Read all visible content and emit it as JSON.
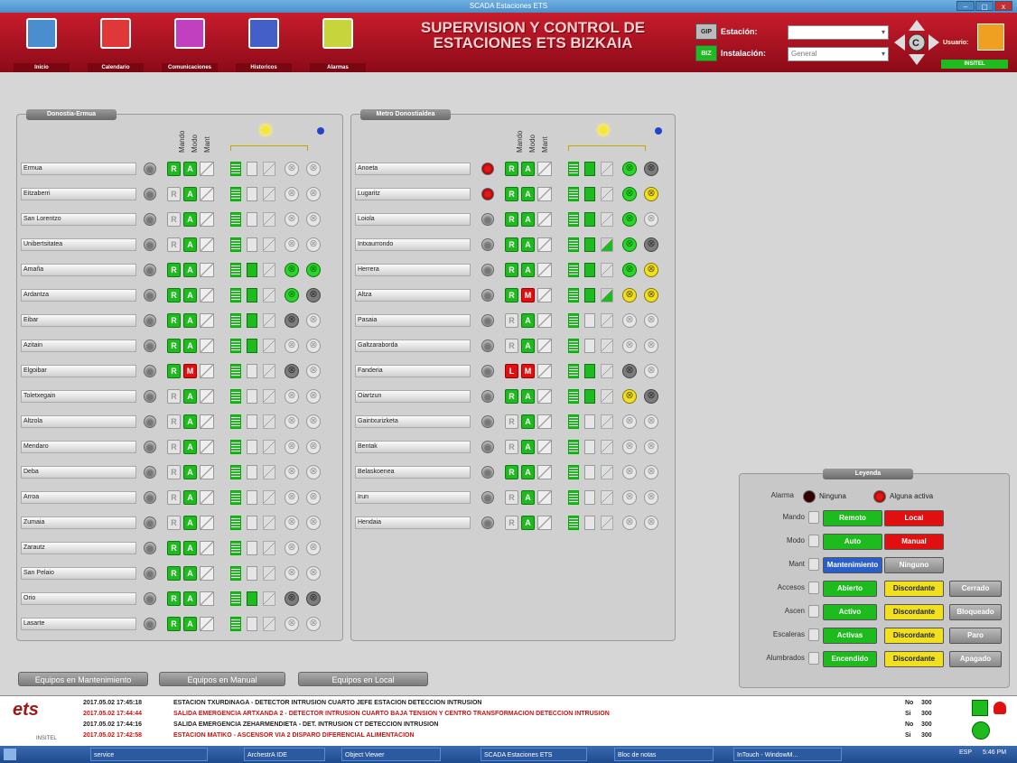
{
  "window": {
    "title": "SCADA Estaciones ETS",
    "min": "–",
    "max": "▢",
    "close": "x"
  },
  "nav": [
    {
      "label": "Inicio",
      "icon": "home-icon",
      "color": "#4a8ed0"
    },
    {
      "label": "Calendario",
      "icon": "calendar-icon",
      "color": "#e03838"
    },
    {
      "label": "Comunicaciones",
      "icon": "communications-icon",
      "color": "#c040c0"
    },
    {
      "label": "Historicos",
      "icon": "chart-icon",
      "color": "#4460c8"
    },
    {
      "label": "Alarmas",
      "icon": "alarm-warning-icon",
      "color": "#c8d43c"
    }
  ],
  "header": {
    "title_line1": "SUPERVISION Y CONTROL DE",
    "title_line2": "ESTACIONES ETS BIZKAIA",
    "gip": "GIP",
    "biz": "BIZ",
    "estacion_label": "Estación:",
    "estacion_value": "",
    "instalacion_label": "Instalación:",
    "instalacion_value": "General",
    "usuario_label": "Usuario:",
    "usuario_value": "INSITEL"
  },
  "columns": {
    "mando": "Mando",
    "modo": "Modo",
    "mant": "Mant"
  },
  "left_panel": {
    "title": "Donostia-Ermua",
    "rows": [
      {
        "n": "Ermua",
        "al": 0,
        "md": "R",
        "mdg": 1,
        "mo": "A",
        "mog": 1,
        "acc": 1,
        "asc": 0,
        "esc": 0,
        "l1": "o",
        "l2": "o"
      },
      {
        "n": "Eitzaberri",
        "al": 0,
        "md": "R",
        "mdg": 0,
        "mo": "A",
        "mog": 1,
        "acc": 1,
        "asc": 0,
        "esc": 0,
        "l1": "o",
        "l2": "o"
      },
      {
        "n": "San Lorentzo",
        "al": 0,
        "md": "R",
        "mdg": 0,
        "mo": "A",
        "mog": 1,
        "acc": 1,
        "asc": 0,
        "esc": 0,
        "l1": "o",
        "l2": "o"
      },
      {
        "n": "Unibertsitatea",
        "al": 0,
        "md": "R",
        "mdg": 0,
        "mo": "A",
        "mog": 1,
        "acc": 1,
        "asc": 0,
        "esc": 0,
        "l1": "o",
        "l2": "o"
      },
      {
        "n": "Amaña",
        "al": 0,
        "md": "R",
        "mdg": 1,
        "mo": "A",
        "mog": 1,
        "acc": 1,
        "asc": 1,
        "esc": 0,
        "l1": "g",
        "l2": "g"
      },
      {
        "n": "Ardantza",
        "al": 0,
        "md": "R",
        "mdg": 1,
        "mo": "A",
        "mog": 1,
        "acc": 1,
        "asc": 1,
        "esc": 0,
        "l1": "g",
        "l2": "d"
      },
      {
        "n": "Eibar",
        "al": 0,
        "md": "R",
        "mdg": 1,
        "mo": "A",
        "mog": 1,
        "acc": 1,
        "asc": 1,
        "esc": 0,
        "l1": "d",
        "l2": "o"
      },
      {
        "n": "Azitain",
        "al": 0,
        "md": "R",
        "mdg": 1,
        "mo": "A",
        "mog": 1,
        "acc": 1,
        "asc": 1,
        "esc": 0,
        "l1": "o",
        "l2": "o"
      },
      {
        "n": "Elgoibar",
        "al": 0,
        "md": "R",
        "mdg": 1,
        "mo": "M",
        "mog": 2,
        "acc": 1,
        "asc": 0,
        "esc": 0,
        "l1": "d",
        "l2": "o"
      },
      {
        "n": "Toletxegain",
        "al": 0,
        "md": "R",
        "mdg": 0,
        "mo": "A",
        "mog": 1,
        "acc": 1,
        "asc": 0,
        "esc": 0,
        "l1": "o",
        "l2": "o"
      },
      {
        "n": "Altzola",
        "al": 0,
        "md": "R",
        "mdg": 0,
        "mo": "A",
        "mog": 1,
        "acc": 1,
        "asc": 0,
        "esc": 0,
        "l1": "o",
        "l2": "o"
      },
      {
        "n": "Mendaro",
        "al": 0,
        "md": "R",
        "mdg": 0,
        "mo": "A",
        "mog": 1,
        "acc": 1,
        "asc": 0,
        "esc": 0,
        "l1": "o",
        "l2": "o"
      },
      {
        "n": "Deba",
        "al": 0,
        "md": "R",
        "mdg": 0,
        "mo": "A",
        "mog": 1,
        "acc": 1,
        "asc": 0,
        "esc": 0,
        "l1": "o",
        "l2": "o"
      },
      {
        "n": "Arroa",
        "al": 0,
        "md": "R",
        "mdg": 0,
        "mo": "A",
        "mog": 1,
        "acc": 1,
        "asc": 0,
        "esc": 0,
        "l1": "o",
        "l2": "o"
      },
      {
        "n": "Zumaia",
        "al": 0,
        "md": "R",
        "mdg": 0,
        "mo": "A",
        "mog": 1,
        "acc": 1,
        "asc": 0,
        "esc": 0,
        "l1": "o",
        "l2": "o"
      },
      {
        "n": "Zarautz",
        "al": 0,
        "md": "R",
        "mdg": 1,
        "mo": "A",
        "mog": 1,
        "acc": 1,
        "asc": 0,
        "esc": 0,
        "l1": "o",
        "l2": "o"
      },
      {
        "n": "San Pelaio",
        "al": 0,
        "md": "R",
        "mdg": 1,
        "mo": "A",
        "mog": 1,
        "acc": 1,
        "asc": 0,
        "esc": 0,
        "l1": "o",
        "l2": "o"
      },
      {
        "n": "Orio",
        "al": 0,
        "md": "R",
        "mdg": 1,
        "mo": "A",
        "mog": 1,
        "acc": 1,
        "asc": 1,
        "esc": 0,
        "l1": "d",
        "l2": "d"
      },
      {
        "n": "Lasarte",
        "al": 0,
        "md": "R",
        "mdg": 1,
        "mo": "A",
        "mog": 1,
        "acc": 1,
        "asc": 0,
        "esc": 0,
        "l1": "o",
        "l2": "o"
      }
    ]
  },
  "right_panel": {
    "title": "Metro Donostialdea",
    "rows": [
      {
        "n": "Anoeta",
        "al": 1,
        "md": "R",
        "mdg": 1,
        "mo": "A",
        "mog": 1,
        "acc": 1,
        "asc": 1,
        "esc": 0,
        "l1": "g",
        "l2": "d"
      },
      {
        "n": "Lugaritz",
        "al": 1,
        "md": "R",
        "mdg": 1,
        "mo": "A",
        "mog": 1,
        "acc": 1,
        "asc": 1,
        "esc": 0,
        "l1": "g",
        "l2": "y"
      },
      {
        "n": "Loiola",
        "al": 0,
        "md": "R",
        "mdg": 1,
        "mo": "A",
        "mog": 1,
        "acc": 1,
        "asc": 1,
        "esc": 0,
        "l1": "g",
        "l2": "o"
      },
      {
        "n": "Intxaurrondo",
        "al": 0,
        "md": "R",
        "mdg": 1,
        "mo": "A",
        "mog": 1,
        "acc": 1,
        "asc": 1,
        "esc": 1,
        "l1": "g",
        "l2": "d"
      },
      {
        "n": "Herrera",
        "al": 0,
        "md": "R",
        "mdg": 1,
        "mo": "A",
        "mog": 1,
        "acc": 1,
        "asc": 1,
        "esc": 0,
        "l1": "g",
        "l2": "y"
      },
      {
        "n": "Altza",
        "al": 0,
        "md": "R",
        "mdg": 1,
        "mo": "M",
        "mog": 2,
        "acc": 1,
        "asc": 1,
        "esc": 1,
        "l1": "y",
        "l2": "y"
      },
      {
        "n": "Pasaia",
        "al": 0,
        "md": "R",
        "mdg": 0,
        "mo": "A",
        "mog": 1,
        "acc": 1,
        "asc": 0,
        "esc": 0,
        "l1": "o",
        "l2": "o"
      },
      {
        "n": "Galtzaraborda",
        "al": 0,
        "md": "R",
        "mdg": 0,
        "mo": "A",
        "mog": 1,
        "acc": 1,
        "asc": 0,
        "esc": 0,
        "l1": "o",
        "l2": "o"
      },
      {
        "n": "Fanderia",
        "al": 0,
        "md": "L",
        "mdg": 2,
        "mo": "M",
        "mog": 2,
        "acc": 1,
        "asc": 1,
        "esc": 0,
        "l1": "d",
        "l2": "o"
      },
      {
        "n": "Oiartzun",
        "al": 0,
        "md": "R",
        "mdg": 1,
        "mo": "A",
        "mog": 1,
        "acc": 1,
        "asc": 1,
        "esc": 0,
        "l1": "y",
        "l2": "d"
      },
      {
        "n": "Gaintxurizketa",
        "al": 0,
        "md": "R",
        "mdg": 0,
        "mo": "A",
        "mog": 1,
        "acc": 1,
        "asc": 0,
        "esc": 0,
        "l1": "o",
        "l2": "o"
      },
      {
        "n": "Bentak",
        "al": 0,
        "md": "R",
        "mdg": 0,
        "mo": "A",
        "mog": 1,
        "acc": 1,
        "asc": 0,
        "esc": 0,
        "l1": "o",
        "l2": "o"
      },
      {
        "n": "Belaskoenea",
        "al": 0,
        "md": "R",
        "mdg": 1,
        "mo": "A",
        "mog": 1,
        "acc": 1,
        "asc": 0,
        "esc": 0,
        "l1": "o",
        "l2": "o"
      },
      {
        "n": "Irun",
        "al": 0,
        "md": "R",
        "mdg": 0,
        "mo": "A",
        "mog": 1,
        "acc": 1,
        "asc": 0,
        "esc": 0,
        "l1": "o",
        "l2": "o"
      },
      {
        "n": "Hendaia",
        "al": 0,
        "md": "R",
        "mdg": 0,
        "mo": "A",
        "mog": 1,
        "acc": 1,
        "asc": 0,
        "esc": 0,
        "l1": "o",
        "l2": "o"
      }
    ]
  },
  "bottom_buttons": [
    "Equipos en Mantenimiento",
    "Equipos en Manual",
    "Equipos en Local"
  ],
  "legend": {
    "title": "Leyenda",
    "alarma": {
      "label": "Alarma",
      "a": "Ninguna",
      "b": "Alguna activa"
    },
    "rows": [
      {
        "label": "Mando",
        "btns": [
          [
            "Remoto",
            "g"
          ],
          [
            "Local",
            "r"
          ]
        ]
      },
      {
        "label": "Modo",
        "btns": [
          [
            "Auto",
            "g"
          ],
          [
            "Manual",
            "r"
          ]
        ]
      },
      {
        "label": "Mant",
        "btns": [
          [
            "Mantenimiento",
            "b"
          ],
          [
            "Ninguno",
            "n"
          ]
        ]
      },
      {
        "label": "Accesos",
        "btns": [
          [
            "Abierto",
            "g"
          ],
          [
            "Discordante",
            "y"
          ],
          [
            "Cerrado",
            "n"
          ]
        ]
      },
      {
        "label": "Ascen",
        "btns": [
          [
            "Activo",
            "g"
          ],
          [
            "Discordante",
            "y"
          ],
          [
            "Bloqueado",
            "n"
          ]
        ]
      },
      {
        "label": "Escaleras",
        "btns": [
          [
            "Activas",
            "g"
          ],
          [
            "Discordante",
            "y"
          ],
          [
            "Paro",
            "n"
          ]
        ]
      },
      {
        "label": "Alumbrados",
        "btns": [
          [
            "Encendido",
            "g"
          ],
          [
            "Discordante",
            "y"
          ],
          [
            "Apagado",
            "n"
          ]
        ]
      }
    ]
  },
  "log": {
    "logo": "ets",
    "sublogo": "INSITEL",
    "rows": [
      {
        "t": "2017.05.02 17:45:18",
        "m": "ESTACION TXURDINAGA - DETECTOR INTRUSION CUARTO JEFE ESTACION DETECCION INTRUSION",
        "a": "No",
        "c": "300",
        "red": 0
      },
      {
        "t": "2017.05.02 17:44:44",
        "m": "SALIDA EMERGENCIA ARTXANDA 2 - DETECTOR INTRUSION CUARTO BAJA TENSION Y CENTRO TRANSFORMACION DETECCION INTRUSION",
        "a": "Si",
        "c": "300",
        "red": 1
      },
      {
        "t": "2017.05.02 17:44:16",
        "m": "SALIDA EMERGENCIA ZEHARMENDIETA - DET. INTRUSION CT DETECCION INTRUSION",
        "a": "No",
        "c": "300",
        "red": 0
      },
      {
        "t": "2017.05.02 17:42:58",
        "m": "ESTACION MATIKO - ASCENSOR VIA 2 DISPARO DIFERENCIAL ALIMENTACION",
        "a": "Si",
        "c": "300",
        "red": 1
      }
    ]
  },
  "taskbar": {
    "items": [
      "service",
      "ArchestrA IDE",
      "Object Viewer",
      "SCADA Estaciones ETS",
      "Bloc de notas",
      "InTouch - WindowM..."
    ],
    "lang": "ESP",
    "time": "5:46 PM"
  }
}
